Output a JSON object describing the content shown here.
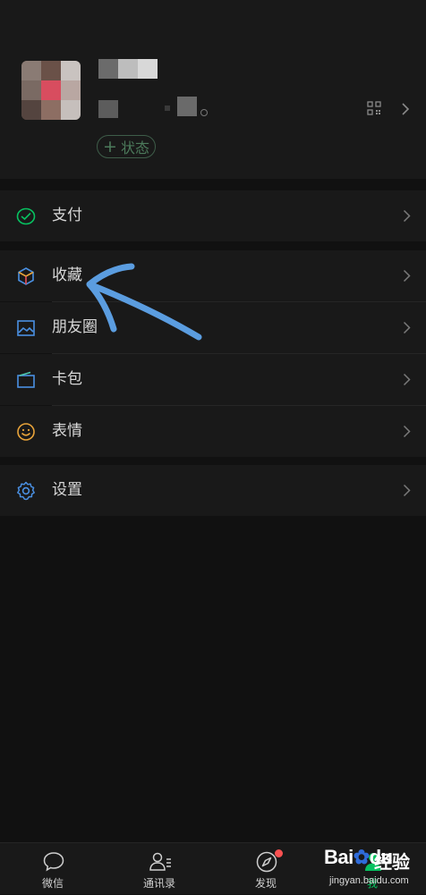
{
  "profile": {
    "status_label": "状态"
  },
  "menu": {
    "pay": "支付",
    "favorites": "收藏",
    "moments": "朋友圈",
    "cards": "卡包",
    "stickers": "表情",
    "settings": "设置"
  },
  "tabs": [
    {
      "label": "微信",
      "icon": "chat-icon"
    },
    {
      "label": "通讯录",
      "icon": "contacts-icon"
    },
    {
      "label": "发现",
      "icon": "compass-icon"
    },
    {
      "label": "我",
      "icon": "me-icon"
    }
  ],
  "watermark": {
    "logo": "Bai",
    "logo_suffix": "du",
    "cn": "经验",
    "url": "jingyan.baidu.com"
  },
  "colors": {
    "pay_green": "#07c160",
    "favorites_blue": "#4a90e2",
    "annotation_arrow": "#5b9de0",
    "badge_red": "#fa5151"
  }
}
